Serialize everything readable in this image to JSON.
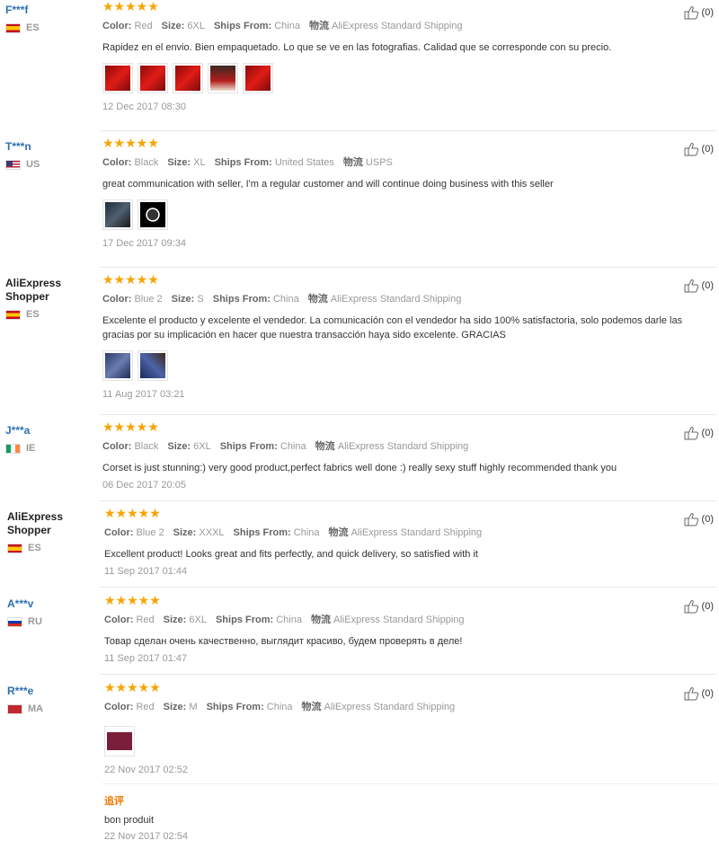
{
  "labels": {
    "color": "Color:",
    "size": "Size:",
    "ships_from": "Ships From:",
    "logistics": "物流"
  },
  "reviews": [
    {
      "user": "F***f",
      "country": "ES",
      "flag": "es",
      "color": "Red",
      "size": "6XL",
      "ships": "China",
      "logistics": "AliExpress Standard Shipping",
      "text": "Rapidez en el envio. Bien empaquetado. Lo que se ve en las fotografias. Calidad que se corresponde con su precio.",
      "date": "12 Dec 2017 08:30",
      "likes": "(0)"
    },
    {
      "user": "T***n",
      "country": "US",
      "flag": "us",
      "color": "Black",
      "size": "XL",
      "ships": "United States",
      "logistics": "USPS",
      "text": "great communication with seller, I'm a regular customer and will continue doing business with this seller",
      "date": "17 Dec 2017 09:34",
      "likes": "(0)"
    },
    {
      "user": "AliExpress Shopper",
      "country": "ES",
      "flag": "es",
      "color": "Blue 2",
      "size": "S",
      "ships": "China",
      "logistics": "AliExpress Standard Shipping",
      "text": "Excelente el producto y excelente el vendedor. La comunicación con el vendedor ha sido 100% satisfactoria, solo podemos darle las gracias por su implicación en hacer que nuestra transacción haya sido excelente. GRACIAS",
      "date": "11 Aug 2017 03:21",
      "likes": "(0)"
    },
    {
      "user": "J***a",
      "country": "IE",
      "flag": "ie",
      "color": "Black",
      "size": "6XL",
      "ships": "China",
      "logistics": "AliExpress Standard Shipping",
      "text": "Corset is just stunning:) very good product,perfect fabrics well done :) really sexy stuff highly recommended thank you",
      "date": "06 Dec 2017 20:05",
      "likes": "(0)"
    },
    {
      "user": "AliExpress Shopper",
      "country": "ES",
      "flag": "es",
      "color": "Blue 2",
      "size": "XXXL",
      "ships": "China",
      "logistics": "AliExpress Standard Shipping",
      "text": "Excellent product! Looks great and fits perfectly, and quick delivery, so satisfied with it",
      "date": "11 Sep 2017 01:44",
      "likes": "(0)"
    },
    {
      "user": "A***v",
      "country": "RU",
      "flag": "ru",
      "color": "Red",
      "size": "6XL",
      "ships": "China",
      "logistics": "AliExpress Standard Shipping",
      "text": "Товар сделан очень качественно, выглядит красиво, будем проверять в деле!",
      "date": "11 Sep 2017 01:47",
      "likes": "(0)"
    },
    {
      "user": "R***e",
      "country": "MA",
      "flag": "ma",
      "color": "Red",
      "size": "M",
      "ships": "China",
      "logistics": "AliExpress Standard Shipping",
      "text": "",
      "date": "22 Nov 2017 02:52",
      "likes": "(0)",
      "additional_label": "追评",
      "additional_text": "bon produit",
      "additional_date": "22 Nov 2017 02:54"
    }
  ],
  "stars": "★★★★★"
}
